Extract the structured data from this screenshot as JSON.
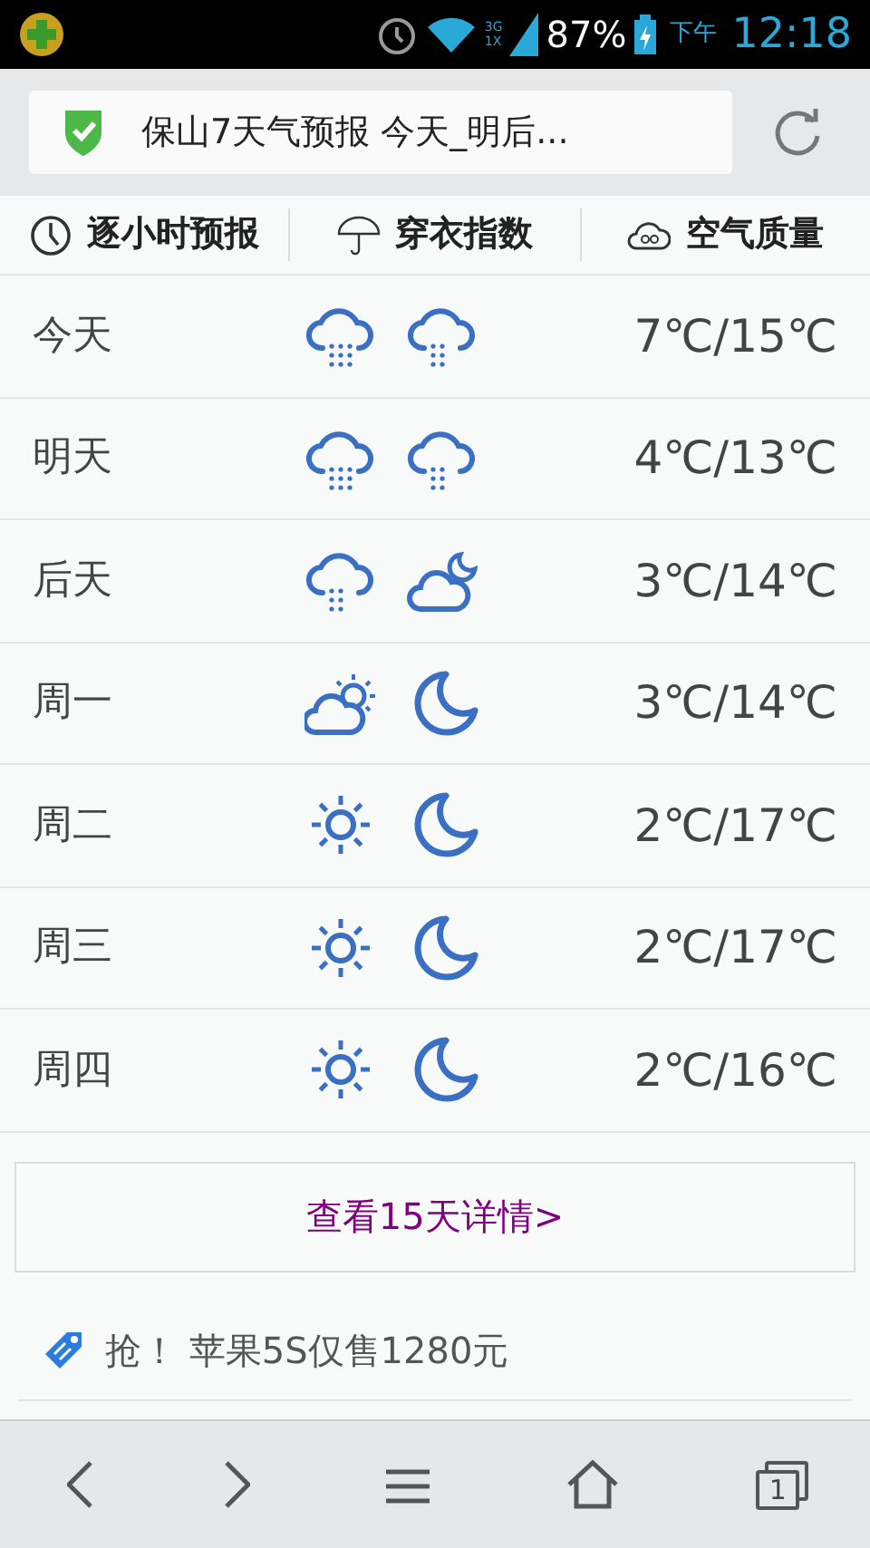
{
  "status_bar": {
    "signal_labels": [
      "3G",
      "1X"
    ],
    "battery": "87%",
    "period": "下午",
    "time": "12:18"
  },
  "address_bar": {
    "title": "保山7天气预报 今天_明后..."
  },
  "tabs": [
    {
      "label": "逐小时预报",
      "kind": "clock"
    },
    {
      "label": "穿衣指数",
      "kind": "umbrella"
    },
    {
      "label": "空气质量",
      "kind": "air"
    }
  ],
  "days": [
    {
      "day": "今天",
      "day_weather": {
        "kind": "rain"
      },
      "night_weather": {
        "kind": "drizzle"
      },
      "temps": "7℃/15℃"
    },
    {
      "day": "明天",
      "day_weather": {
        "kind": "rain"
      },
      "night_weather": {
        "kind": "drizzle"
      },
      "temps": "4℃/13℃"
    },
    {
      "day": "后天",
      "day_weather": {
        "kind": "drizzle"
      },
      "night_weather": {
        "kind": "cloudy"
      },
      "temps": "3℃/14℃"
    },
    {
      "day": "周一",
      "day_weather": {
        "kind": "overcast"
      },
      "night_weather": {
        "kind": "clear"
      },
      "temps": "3℃/14℃"
    },
    {
      "day": "周二",
      "day_weather": {
        "kind": "sunny"
      },
      "night_weather": {
        "kind": "clear"
      },
      "temps": "2℃/17℃"
    },
    {
      "day": "周三",
      "day_weather": {
        "kind": "sunny"
      },
      "night_weather": {
        "kind": "clear"
      },
      "temps": "2℃/17℃"
    },
    {
      "day": "周四",
      "day_weather": {
        "kind": "sunny"
      },
      "night_weather": {
        "kind": "clear"
      },
      "temps": "2℃/16℃"
    }
  ],
  "details_link": "查看15天详情>",
  "promo": "抢！ 苹果5S仅售1280元",
  "nav": {
    "tab_count": "1"
  }
}
